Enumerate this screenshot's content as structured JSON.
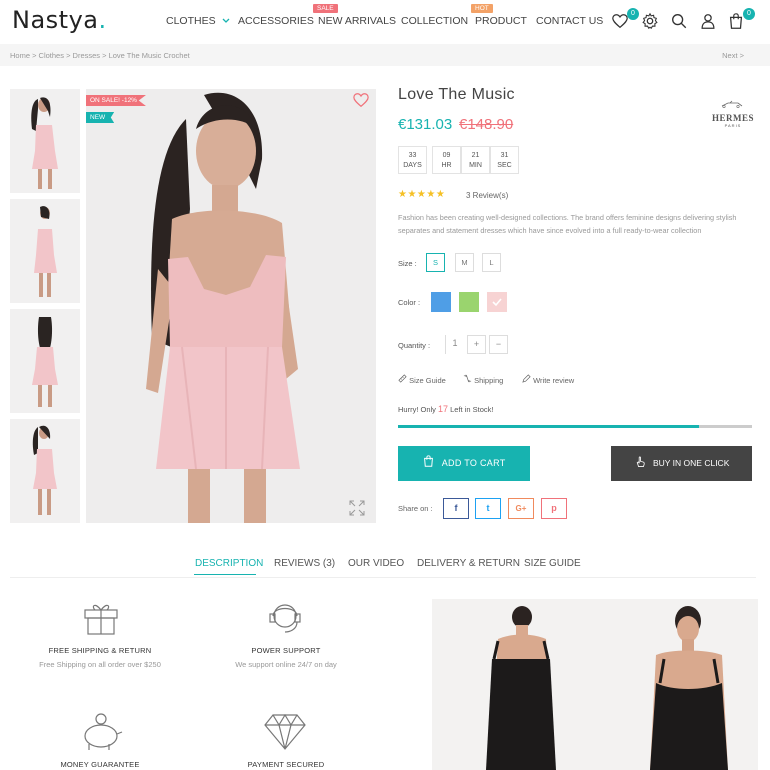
{
  "header": {
    "logo": "Nastya",
    "logo_dot": ".",
    "nav": [
      "CLOTHES",
      "ACCESSORIES",
      "NEW ARRIVALS",
      "COLLECTION",
      "PRODUCT",
      "CONTACT US"
    ],
    "badge_sale": "SALE",
    "badge_hot": "HOT",
    "wishlist_count": "0",
    "cart_count": "0"
  },
  "breadcrumb": {
    "path": "Home  >  Clothes  >  Dresses  >  Love The Music Crochet",
    "next": "Next  >"
  },
  "gallery": {
    "tag_sale": "ON SALE! -12%",
    "tag_new": "NEW"
  },
  "product": {
    "title": "Love The Music",
    "price_new": "€131.03",
    "price_old": "€148.90",
    "brand_name": "HERMES",
    "brand_city": "PARIS",
    "countdown": [
      {
        "value": "33",
        "unit": "DAYS"
      },
      {
        "value": "09",
        "unit": "HR"
      },
      {
        "value": "21",
        "unit": "MIN"
      },
      {
        "value": "31",
        "unit": "SEC"
      }
    ],
    "stars": "★★★★★",
    "rating": 5,
    "reviews": "3 Review(s)",
    "description": "Fashion has been creating well-designed collections. The brand offers feminine designs delivering stylish separates and statement dresses which have since evolved into a full ready-to-wear collection",
    "size_label": "Size :",
    "sizes": [
      "S",
      "M",
      "L"
    ],
    "color_label": "Color :",
    "colors": [
      "#4f9ee6",
      "#9ad46e",
      "#f7d3d3"
    ],
    "quantity_label": "Quantity :",
    "quantity": "1",
    "plus": "+",
    "minus": "−",
    "size_guide": "Size Guide",
    "shipping": "Shipping",
    "write_review": "Write review",
    "hurry_pre": "Hurry! Only",
    "stock_left": "17",
    "hurry_post": "Left in Stock!",
    "stock_fraction": 0.85,
    "add_to_cart": "ADD TO CART",
    "buy_now": "BUY IN ONE CLICK",
    "share_label": "Share on :",
    "social": [
      "f",
      "t",
      "G+",
      "p"
    ]
  },
  "tabs": [
    "DESCRIPTION",
    "REVIEWS (3)",
    "OUR VIDEO",
    "DELIVERY & RETURN",
    "SIZE GUIDE"
  ],
  "features": [
    {
      "title": "FREE SHIPPING & RETURN",
      "sub": "Free Shipping on all order over $250"
    },
    {
      "title": "POWER SUPPORT",
      "sub": "We support online 24/7 on day"
    },
    {
      "title": "MONEY GUARANTEE",
      "sub": ""
    },
    {
      "title": "PAYMENT SECURED",
      "sub": ""
    }
  ],
  "colors": {
    "accent": "#17b3b0",
    "sale": "#f0727a",
    "hot": "#f3a267",
    "dark_button": "#444444"
  }
}
